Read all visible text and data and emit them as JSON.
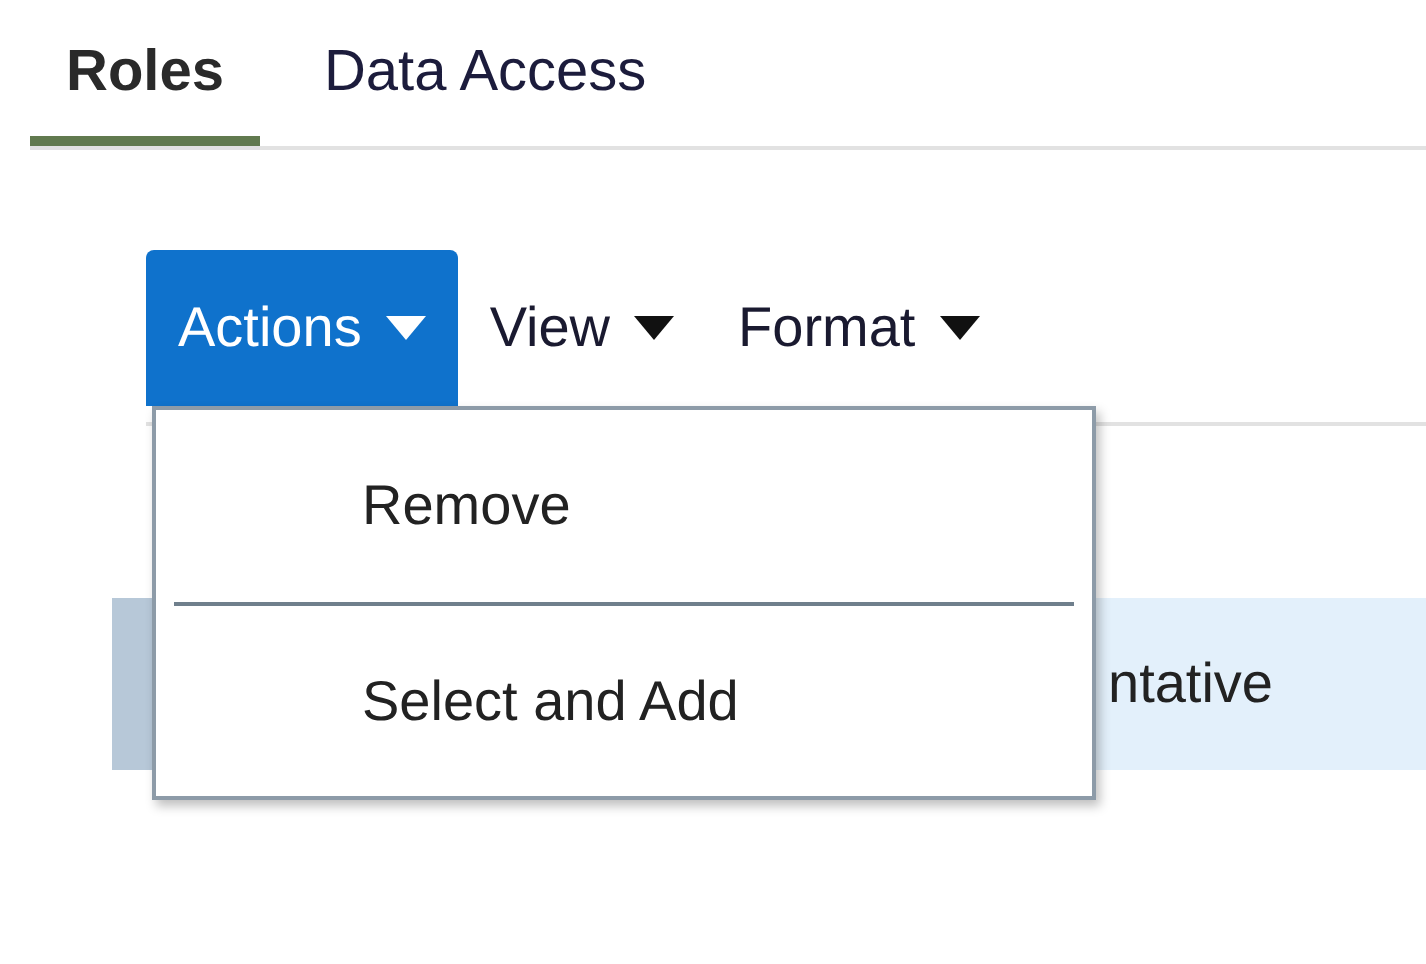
{
  "tabs": [
    {
      "label": "Roles",
      "selected": true
    },
    {
      "label": "Data Access",
      "selected": false
    }
  ],
  "toolbar": [
    {
      "label": "Actions",
      "kind": "menu",
      "expanded": true
    },
    {
      "label": "View",
      "kind": "menu",
      "expanded": false
    },
    {
      "label": "Format",
      "kind": "menu",
      "expanded": false
    }
  ],
  "actions_menu": {
    "items": [
      {
        "label": "Remove"
      },
      {
        "label": "Select and Add"
      }
    ]
  },
  "table": {
    "rows": [
      {
        "column_1": "ntative",
        "selected": true
      }
    ]
  }
}
